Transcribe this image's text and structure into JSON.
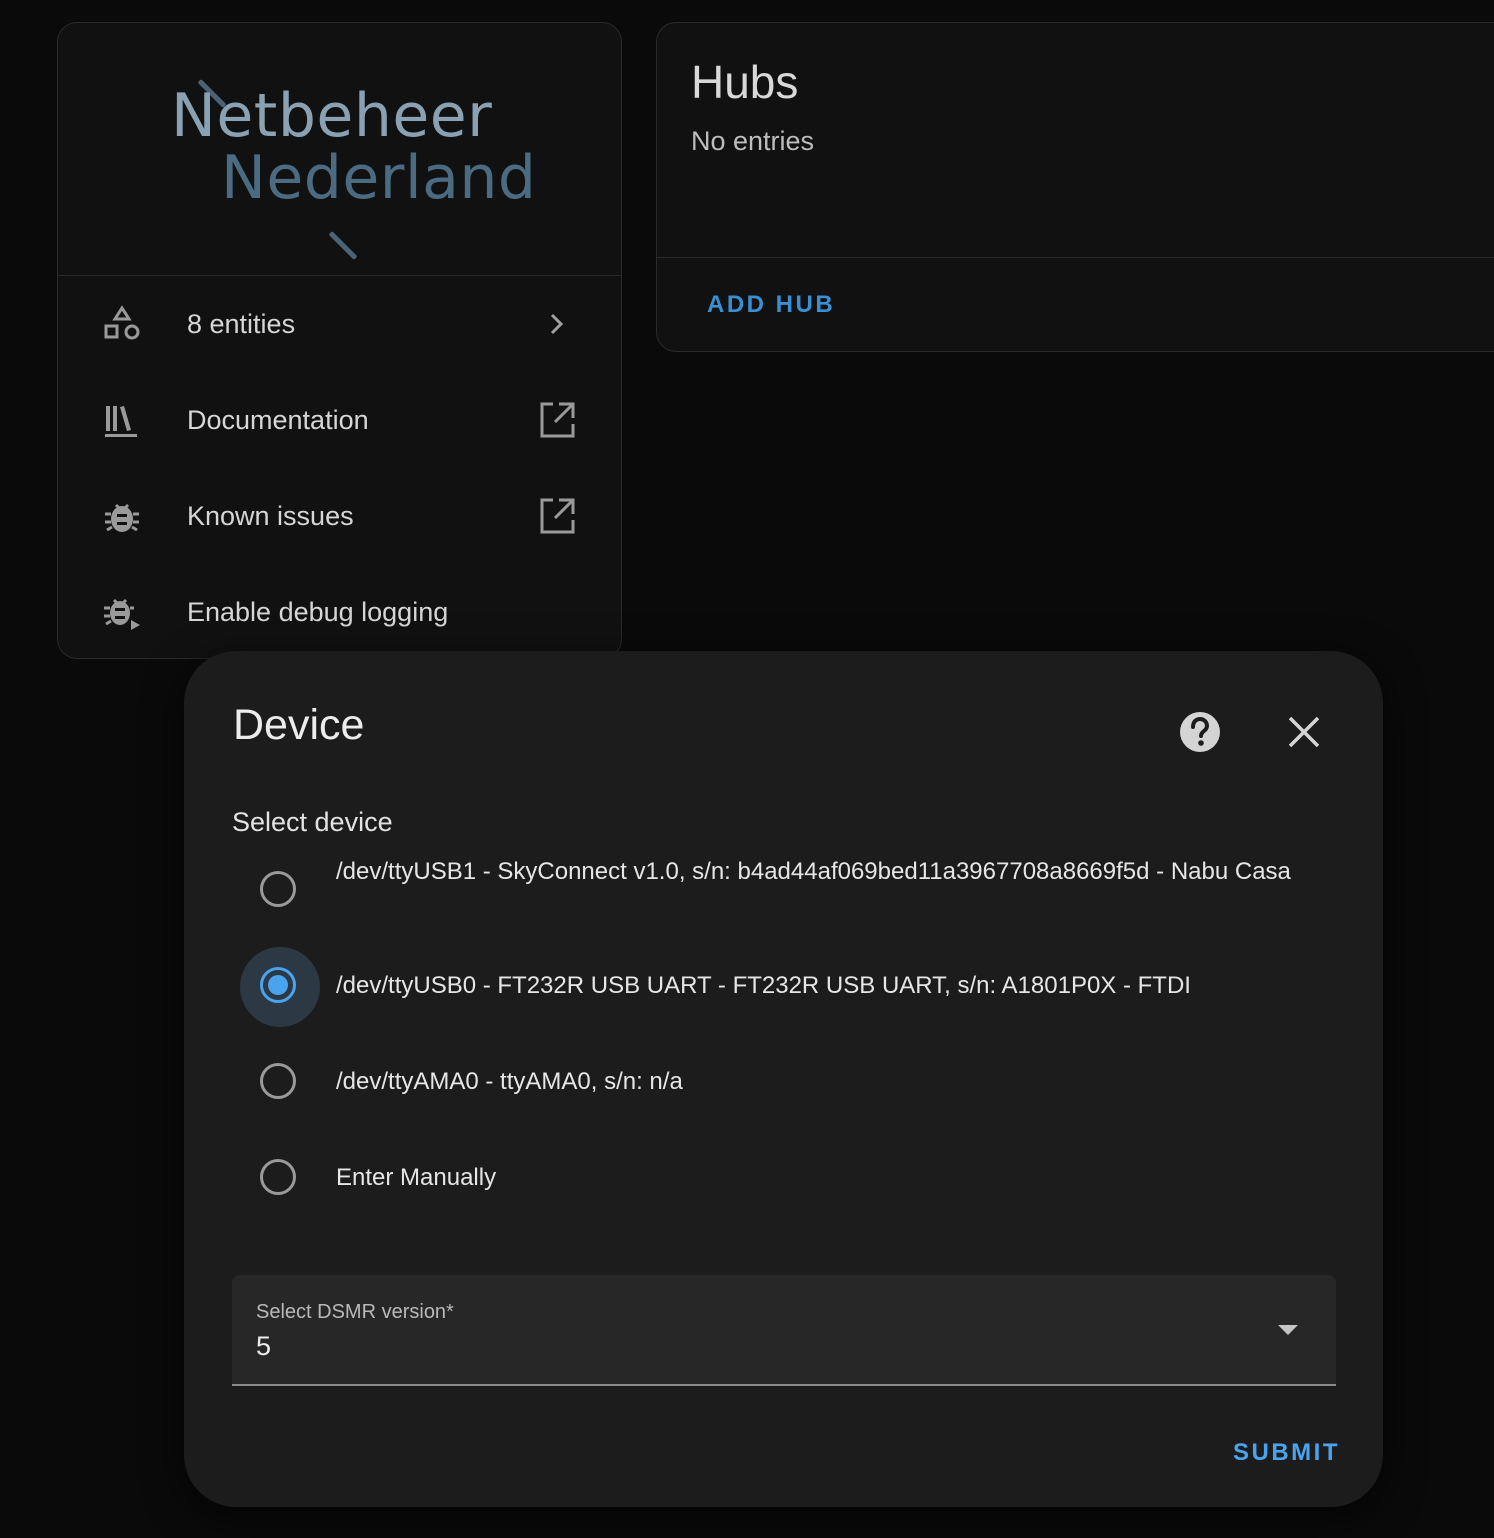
{
  "integration": {
    "logo": {
      "line1": "Netbeheer",
      "line2": "Nederland"
    },
    "menu": [
      {
        "icon": "shapes-icon",
        "label": "8 entities",
        "trailing": "chevron-right-icon"
      },
      {
        "icon": "library-icon",
        "label": "Documentation",
        "trailing": "open-in-new-icon"
      },
      {
        "icon": "bug-icon",
        "label": "Known issues",
        "trailing": "open-in-new-icon"
      },
      {
        "icon": "bug-play-icon",
        "label": "Enable debug logging",
        "trailing": ""
      }
    ]
  },
  "hubs": {
    "title": "Hubs",
    "empty_text": "No entries",
    "add_button": "ADD HUB"
  },
  "dialog": {
    "title": "Device",
    "section_label": "Select device",
    "options": [
      {
        "label": "/dev/ttyUSB1 - SkyConnect v1.0, s/n: b4ad44af069bed11a3967708a8669f5d - Nabu Casa",
        "checked": false
      },
      {
        "label": "/dev/ttyUSB0 - FT232R USB UART - FT232R USB UART, s/n: A1801P0X - FTDI",
        "checked": true
      },
      {
        "label": "/dev/ttyAMA0 - ttyAMA0, s/n: n/a",
        "checked": false
      },
      {
        "label": "Enter Manually",
        "checked": false
      }
    ],
    "dsmr_select": {
      "label": "Select DSMR version*",
      "value": "5"
    },
    "submit_label": "SUBMIT"
  },
  "colors": {
    "accent": "#4aa3ee",
    "background": "#0a0a0a",
    "card": "#111111",
    "dialog": "#1c1c1c"
  }
}
